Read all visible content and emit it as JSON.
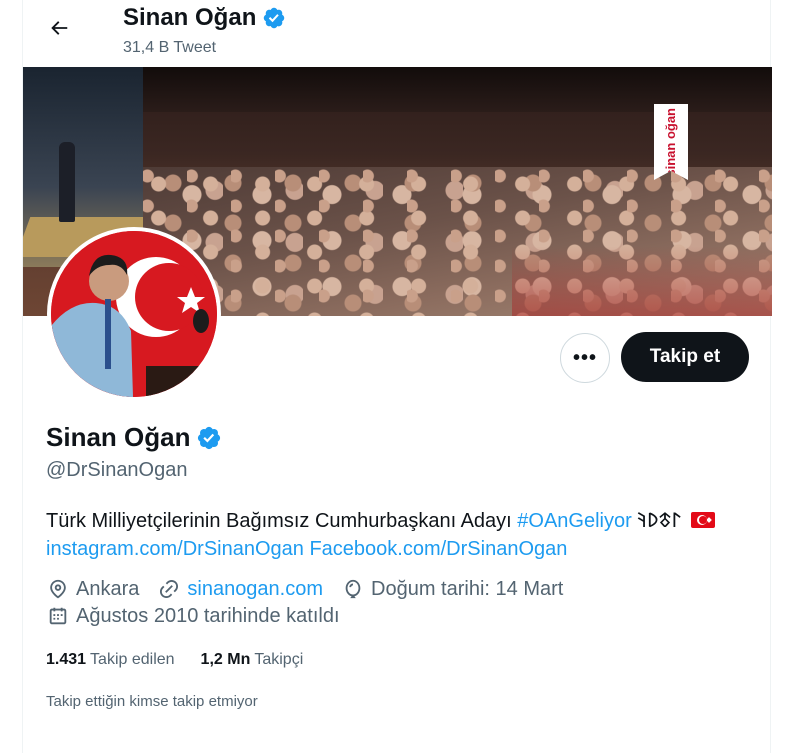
{
  "header": {
    "name": "Sinan Oğan",
    "tweet_count": "31,4 B Tweet"
  },
  "banner": {
    "sign_text": "sinan oğan"
  },
  "profile": {
    "name": "Sinan Oğan",
    "handle": "@DrSinanOgan",
    "bio_text": "Türk Milliyetçilerinin Bağımsız Cumhurbaşkanı Adayı ",
    "bio_hashtag": "#OAnGeliyor",
    "bio_runes": "𐰃𐱃𐰖𐰚",
    "bio_link_instagram": "instagram.com/DrSinanOgan",
    "bio_link_facebook": "Facebook.com/DrSinanOgan",
    "location": "Ankara",
    "website": "sinanogan.com",
    "birthday": "Doğum tarihi: 14 Mart",
    "joined": "Ağustos 2010 tarihinde katıldı"
  },
  "actions": {
    "more_label": "•••",
    "follow_label": "Takip et"
  },
  "stats": {
    "following_count": "1.431",
    "following_label": "Takip edilen",
    "followers_count": "1,2 Mn",
    "followers_label": "Takipçi"
  },
  "known_followers": "Takip ettiğin kimse takip etmiyor",
  "colors": {
    "accent": "#1d9bf0",
    "text_primary": "#0f1419",
    "text_secondary": "#536471",
    "follow_button_bg": "#0f1419"
  },
  "icons": [
    "back-arrow-icon",
    "verified-badge-icon",
    "location-pin-icon",
    "link-icon",
    "balloon-icon",
    "calendar-icon"
  ]
}
